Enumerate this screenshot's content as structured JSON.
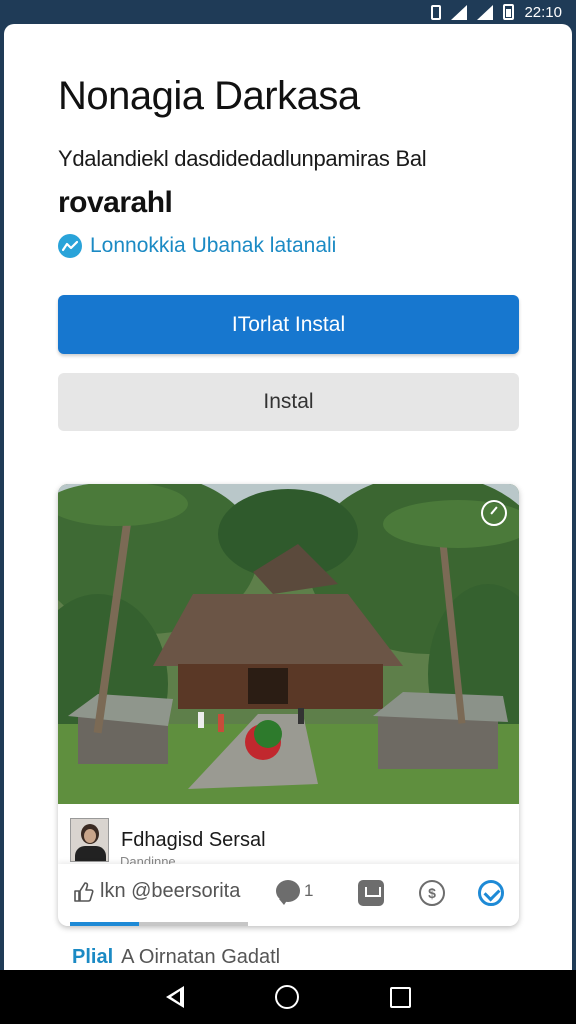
{
  "status_bar": {
    "time": "22:10",
    "icons": [
      "vibrate-icon",
      "signal-icon",
      "signal-icon",
      "battery-icon"
    ]
  },
  "app": {
    "title": "Nonagia Darkasa",
    "subtitle": "Ydalandiekl dasdidedadlunpamiras Bal",
    "subtitle_bold": "rovarahl",
    "link_text": "Lonnokkia Ubanak latanali",
    "link_icon": "trend-icon"
  },
  "buttons": {
    "primary_label": "ITorlat Instal",
    "secondary_label": "Instal"
  },
  "post": {
    "photo_subject": "traditional house in tropical garden",
    "author_name": "Fdhagisd Sersal",
    "author_sub": "Dandinne",
    "like_label": "lkn @beersorita",
    "comment_count": "1",
    "money_glyph": "$",
    "progress_percent": 39
  },
  "footer": {
    "link": "Plial",
    "text": "A Oirnatan Gadatl"
  },
  "nav_bar": {
    "icons": [
      "back-icon",
      "home-icon",
      "recents-icon"
    ]
  },
  "colors": {
    "primary": "#1777cf",
    "status_bar": "#1f3b57",
    "link": "#1b8ac4",
    "check": "#1e8ad6"
  }
}
